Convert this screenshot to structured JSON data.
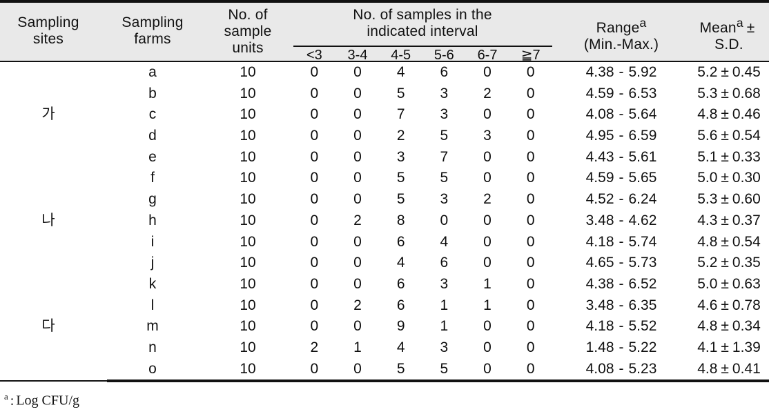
{
  "table": {
    "headers": {
      "sites": {
        "l1": "Sampling",
        "l2": "sites"
      },
      "farms": {
        "l1": "Sampling",
        "l2": "farms"
      },
      "units": {
        "l1": "No. of",
        "l2": "sample",
        "l3": "units"
      },
      "interval_group": {
        "l1": "No. of   samples in  the",
        "l2": "indicated  interval"
      },
      "interval_bins": [
        "<3",
        "3-4",
        "4-5",
        "5-6",
        "6-7",
        "≧7"
      ],
      "range": {
        "l1": "Range",
        "sup": "a",
        "l2": "(Min.-Max.)"
      },
      "mean": {
        "l1": "Mean",
        "sup": "a",
        "pm": "±",
        "l2": "S.D."
      }
    },
    "rows": [
      {
        "site": "",
        "farm": "a",
        "units": "10",
        "bins": [
          "0",
          "0",
          "4",
          "6",
          "0",
          "0"
        ],
        "range_min": "4.38",
        "range_max": "5.92",
        "mean": "5.2",
        "sd": "0.45"
      },
      {
        "site": "",
        "farm": "b",
        "units": "10",
        "bins": [
          "0",
          "0",
          "5",
          "3",
          "2",
          "0"
        ],
        "range_min": "4.59",
        "range_max": "6.53",
        "mean": "5.3",
        "sd": "0.68"
      },
      {
        "site": "가",
        "farm": "c",
        "units": "10",
        "bins": [
          "0",
          "0",
          "7",
          "3",
          "0",
          "0"
        ],
        "range_min": "4.08",
        "range_max": "5.64",
        "mean": "4.8",
        "sd": "0.46"
      },
      {
        "site": "",
        "farm": "d",
        "units": "10",
        "bins": [
          "0",
          "0",
          "2",
          "5",
          "3",
          "0"
        ],
        "range_min": "4.95",
        "range_max": "6.59",
        "mean": "5.6",
        "sd": "0.54"
      },
      {
        "site": "",
        "farm": "e",
        "units": "10",
        "bins": [
          "0",
          "0",
          "3",
          "7",
          "0",
          "0"
        ],
        "range_min": "4.43",
        "range_max": "5.61",
        "mean": "5.1",
        "sd": "0.33"
      },
      {
        "site": "",
        "farm": "f",
        "units": "10",
        "bins": [
          "0",
          "0",
          "5",
          "5",
          "0",
          "0"
        ],
        "range_min": "4.59",
        "range_max": "5.65",
        "mean": "5.0",
        "sd": "0.30"
      },
      {
        "site": "",
        "farm": "g",
        "units": "10",
        "bins": [
          "0",
          "0",
          "5",
          "3",
          "2",
          "0"
        ],
        "range_min": "4.52",
        "range_max": "6.24",
        "mean": "5.3",
        "sd": "0.60"
      },
      {
        "site": "나",
        "farm": "h",
        "units": "10",
        "bins": [
          "0",
          "2",
          "8",
          "0",
          "0",
          "0"
        ],
        "range_min": "3.48",
        "range_max": "4.62",
        "mean": "4.3",
        "sd": "0.37"
      },
      {
        "site": "",
        "farm": "i",
        "units": "10",
        "bins": [
          "0",
          "0",
          "6",
          "4",
          "0",
          "0"
        ],
        "range_min": "4.18",
        "range_max": "5.74",
        "mean": "4.8",
        "sd": "0.54"
      },
      {
        "site": "",
        "farm": "j",
        "units": "10",
        "bins": [
          "0",
          "0",
          "4",
          "6",
          "0",
          "0"
        ],
        "range_min": "4.65",
        "range_max": "5.73",
        "mean": "5.2",
        "sd": "0.35"
      },
      {
        "site": "",
        "farm": "k",
        "units": "10",
        "bins": [
          "0",
          "0",
          "6",
          "3",
          "1",
          "0"
        ],
        "range_min": "4.38",
        "range_max": "6.52",
        "mean": "5.0",
        "sd": "0.63"
      },
      {
        "site": "",
        "farm": "l",
        "units": "10",
        "bins": [
          "0",
          "2",
          "6",
          "1",
          "1",
          "0"
        ],
        "range_min": "3.48",
        "range_max": "6.35",
        "mean": "4.6",
        "sd": "0.78"
      },
      {
        "site": "다",
        "farm": "m",
        "units": "10",
        "bins": [
          "0",
          "0",
          "9",
          "1",
          "0",
          "0"
        ],
        "range_min": "4.18",
        "range_max": "5.52",
        "mean": "4.8",
        "sd": "0.34"
      },
      {
        "site": "",
        "farm": "n",
        "units": "10",
        "bins": [
          "2",
          "1",
          "4",
          "3",
          "0",
          "0"
        ],
        "range_min": "1.48",
        "range_max": "5.22",
        "mean": "4.1",
        "sd": "1.39"
      },
      {
        "site": "",
        "farm": "o",
        "units": "10",
        "bins": [
          "0",
          "0",
          "5",
          "5",
          "0",
          "0"
        ],
        "range_min": "4.08",
        "range_max": "5.23",
        "mean": "4.8",
        "sd": "0.41"
      }
    ],
    "symbols": {
      "dash": "-",
      "plusminus": "±"
    },
    "footnote": {
      "sup": "a",
      "sep": ":",
      "text": "Log  CFU/g"
    }
  },
  "colors": {
    "header_bg": "#e9e9e9",
    "rule": "#111111",
    "text": "#111111"
  }
}
